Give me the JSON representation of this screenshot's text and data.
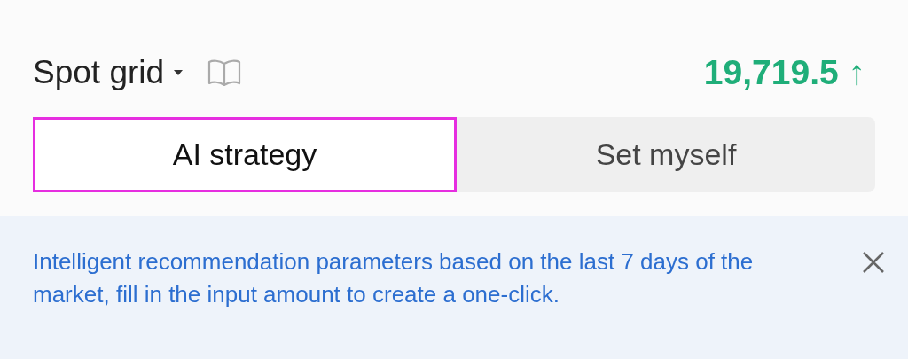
{
  "header": {
    "title": "Spot grid",
    "price": "19,719.5 ↑"
  },
  "tabs": [
    {
      "label": "AI strategy",
      "selected": true
    },
    {
      "label": "Set myself",
      "selected": false
    }
  ],
  "notice": {
    "text": "Intelligent recommendation parameters based on the last 7 days of the market, fill in the input amount to create a one-click."
  }
}
